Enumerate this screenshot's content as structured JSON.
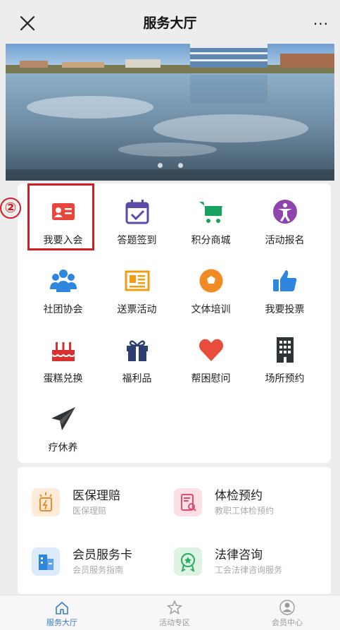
{
  "header": {
    "title": "服务大厅",
    "more": "···"
  },
  "banner": {
    "dots": 2
  },
  "grid": [
    {
      "label": "我要入会",
      "icon": "member-card-icon",
      "color": "#e8453c"
    },
    {
      "label": "答题签到",
      "icon": "calendar-check-icon",
      "color": "#5b4aa8"
    },
    {
      "label": "积分商城",
      "icon": "shopping-cart-icon",
      "color": "#1aa260"
    },
    {
      "label": "活动报名",
      "icon": "accessibility-icon",
      "color": "#8e44ad"
    },
    {
      "label": "社团协会",
      "icon": "group-icon",
      "color": "#2e86de"
    },
    {
      "label": "送票活动",
      "icon": "newspaper-icon",
      "color": "#f39c12"
    },
    {
      "label": "文体培训",
      "icon": "soccer-ball-icon",
      "color": "#f08a24"
    },
    {
      "label": "我要投票",
      "icon": "thumbs-up-icon",
      "color": "#2e86de"
    },
    {
      "label": "蛋糕兑换",
      "icon": "cake-icon",
      "color": "#d63031"
    },
    {
      "label": "福利品",
      "icon": "gift-icon",
      "color": "#2c3e70"
    },
    {
      "label": "帮困慰问",
      "icon": "heart-icon",
      "color": "#e74c3c"
    },
    {
      "label": "场所预约",
      "icon": "building-icon",
      "color": "#2d3436"
    },
    {
      "label": "疗休养",
      "icon": "paper-plane-icon",
      "color": "#2d3436"
    }
  ],
  "annotation": {
    "marker": "②"
  },
  "services": [
    {
      "title": "医保理赔",
      "subtitle": "医保理赔",
      "icon": "medical-claim-icon",
      "bg": "#fdebd9",
      "color": "#f08a24"
    },
    {
      "title": "体检预约",
      "subtitle": "教职工体检预约",
      "icon": "checkup-icon",
      "bg": "#fde0e6",
      "color": "#e84a6f"
    },
    {
      "title": "会员服务卡",
      "subtitle": "会员服务指南",
      "icon": "service-card-icon",
      "bg": "#dcebfb",
      "color": "#2e86de"
    },
    {
      "title": "法律咨询",
      "subtitle": "工会法律咨询服务",
      "icon": "legal-icon",
      "bg": "#dff3e4",
      "color": "#27ae60"
    }
  ],
  "tabs": [
    {
      "label": "服务大厅",
      "icon": "home-icon",
      "active": true
    },
    {
      "label": "活动专区",
      "icon": "star-icon",
      "active": false
    },
    {
      "label": "会员中心",
      "icon": "user-icon",
      "active": false
    }
  ]
}
